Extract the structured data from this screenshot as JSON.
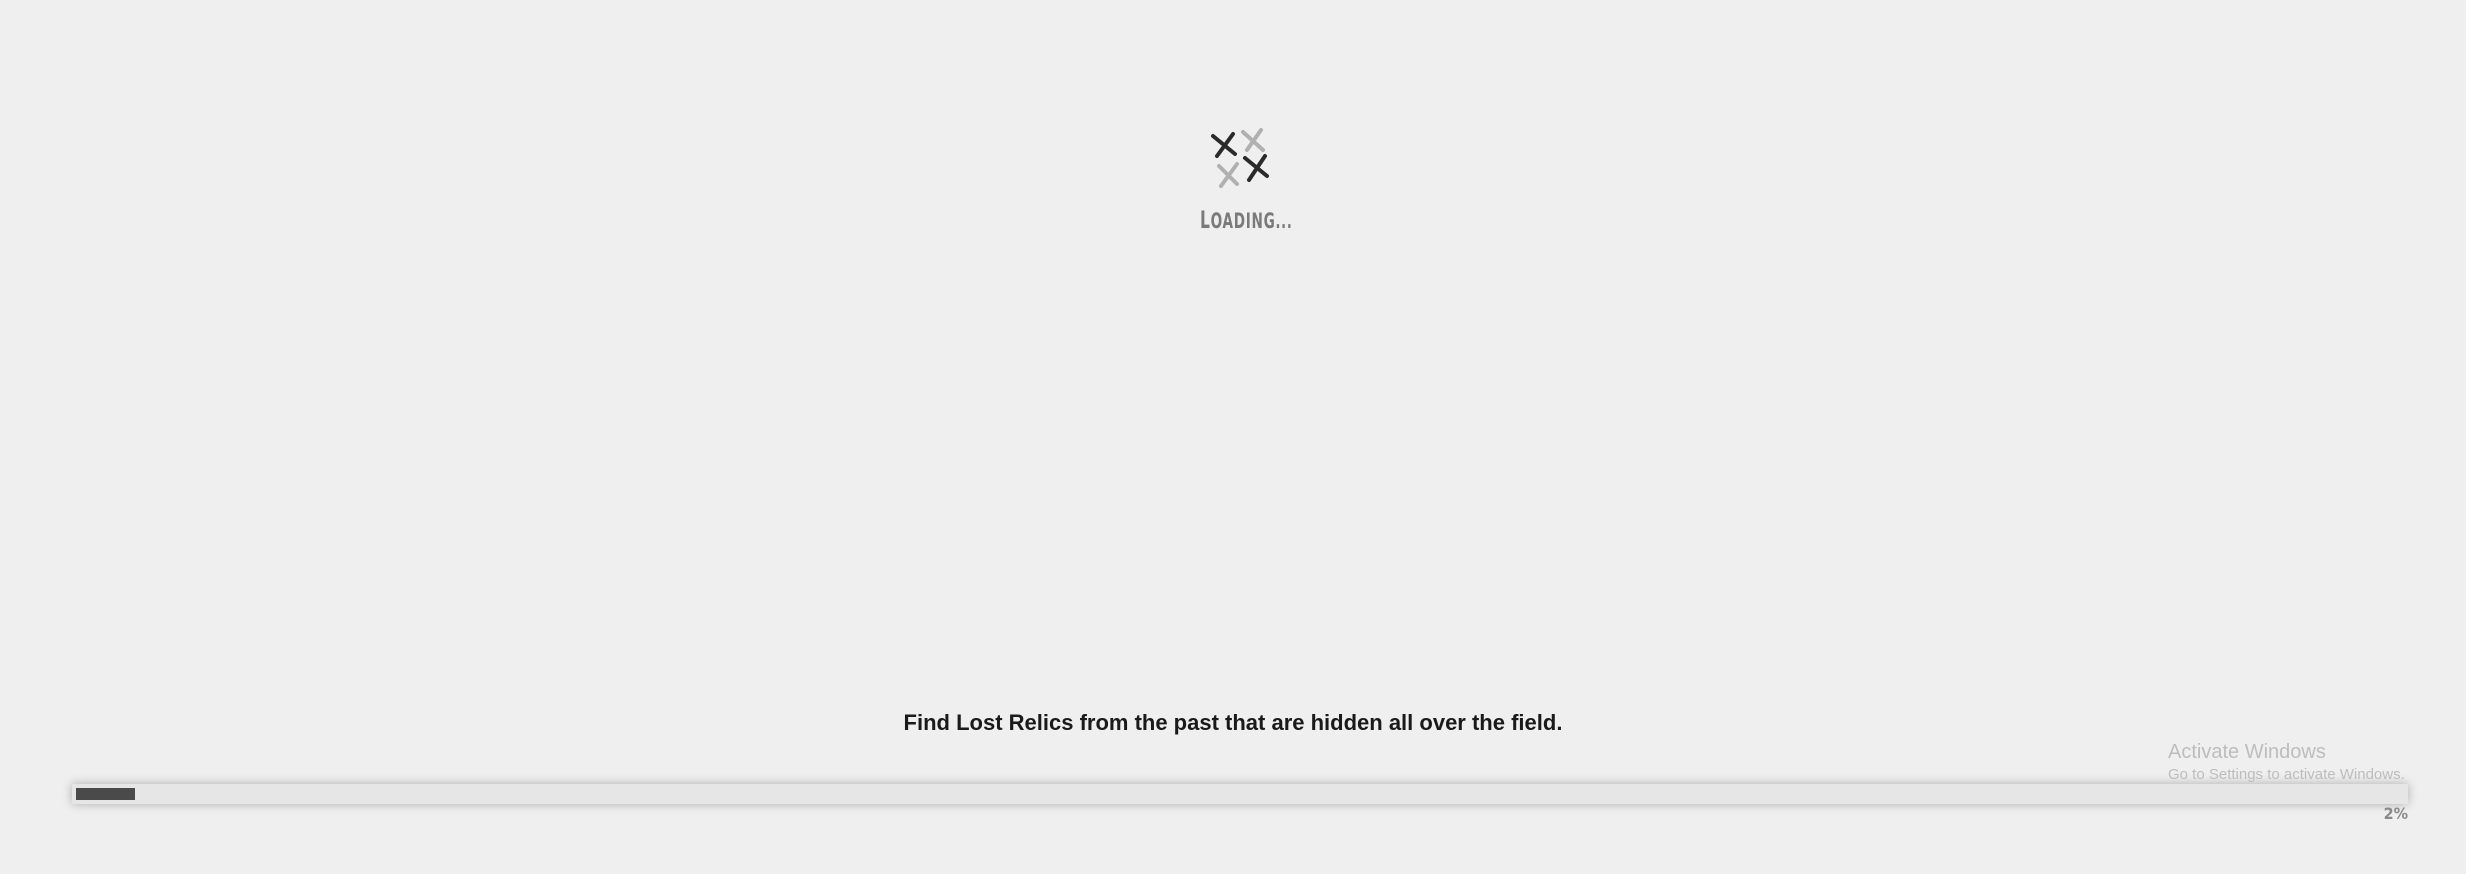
{
  "loader": {
    "text_first": "L",
    "text_rest": "OADING",
    "text_dots": "..."
  },
  "tip": {
    "text": "Find Lost Relics from the past that are hidden all over the field."
  },
  "progress": {
    "value_percent": 2,
    "label": "2%"
  },
  "watermark": {
    "title": "Activate Windows",
    "subtitle": "Go to Settings to activate Windows."
  },
  "colors": {
    "background": "#efefef",
    "spinner_dark": "#2a2a2a",
    "spinner_light": "#b0b0b0",
    "progress_fill": "#4a4a4a",
    "progress_track": "#e6e6e6"
  }
}
